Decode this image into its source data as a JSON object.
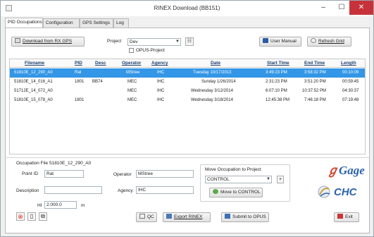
{
  "window": {
    "title": "RINEX Download (BB151)",
    "min": "–",
    "max": "☐",
    "close": "✕"
  },
  "tabs": [
    "PID Occupations",
    "Configuration",
    "GPS Settings",
    "Log"
  ],
  "toolbar": {
    "download_label": "Download from RX GPS",
    "project_label": "Project",
    "project_value": "Dev",
    "opus_projects_label": "OPUS-Project",
    "user_manual_label": "User Manual",
    "refresh_label": "Refresh Grid"
  },
  "grid": {
    "columns": [
      "Filename",
      "PID",
      "Desc",
      "Operator",
      "Agency",
      "Date",
      "Start Time",
      "End Time",
      "Length"
    ],
    "rows": [
      [
        "51810E_12_290_A0",
        "Rat",
        "",
        "MStree",
        "IHC",
        "Tuesday 10/17/2013",
        "3:49:23 PM",
        "3:58:32 PM",
        "00:10:09"
      ],
      [
        "51810E_14_016_A1",
        "1801",
        "BB74",
        "MEC",
        "IHC",
        "Sunday 1/26/2014",
        "2:31:23 PM",
        "3:51:20 PM",
        "00:59:45"
      ],
      [
        "51712E_14_072_A0",
        "",
        "",
        "MEC",
        "IHC",
        "Wednesday 3/12/2014",
        "6:07:10 PM",
        "10:37:52 PM",
        "04:30:37"
      ],
      [
        "51810E_15_078_A0",
        "1801",
        "",
        "MEC",
        "IHC",
        "Wednesday 3/18/2014",
        "12:45:38 PM",
        "7:46:18 PM",
        "07:19:48"
      ]
    ]
  },
  "occupation": {
    "file_label": "Occupation File 51810E_12_290_A0",
    "point_id_label": "Point ID",
    "point_id_value": "Rat",
    "description_label": "Description",
    "description_value": "",
    "operator_label": "Operator",
    "operator_value": "MStree",
    "agency_label": "Agency",
    "agency_value": "IHC",
    "hi_label": "HI",
    "hi_value": "2.000.0",
    "hi_unit": "m"
  },
  "move_group": {
    "title": "Move Occupation to Project",
    "select_value": "CONTROL",
    "plus_label": "+",
    "move_button_label": "Move to CONTROL"
  },
  "bottom_buttons": {
    "qc_label": "QC",
    "export_label": "Export RINEX",
    "submit_label": "Submit to OPUS",
    "exit_label": "Exit"
  },
  "logos": {
    "gage": "Gage",
    "chc": "CHC"
  },
  "colors": {
    "selection": "#3396e6",
    "header_text": "#1e3f6e",
    "accent": "#2c62b0",
    "close": "#c7323a"
  }
}
